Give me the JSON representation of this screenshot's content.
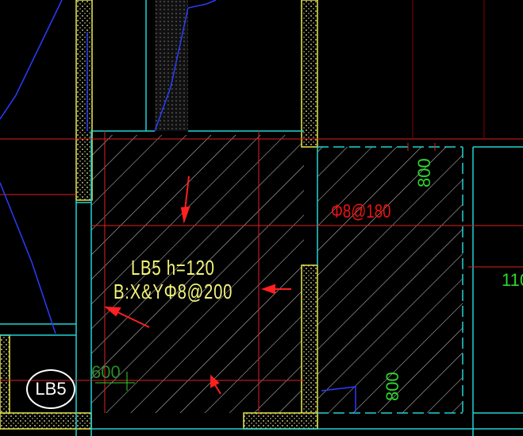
{
  "slab_tag": "LB5",
  "slab_label_line1": "LB5  h=120",
  "slab_label_line2": "B:X&YΦ8@200",
  "rebar_note": "Φ8@180",
  "dim_top_right": "800",
  "dim_bottom_right": "800",
  "dim_left": "600",
  "dim_right_edge": "110",
  "colors": {
    "background": "#000000",
    "wall_line": "#e8e84a",
    "axis_line": "#e02020",
    "outline_cyan": "#22d3d3",
    "hatch": "#cfcfcf",
    "blue_line": "#2a3cff",
    "arrow": "#ff2020",
    "text_green": "#2fd52f"
  }
}
